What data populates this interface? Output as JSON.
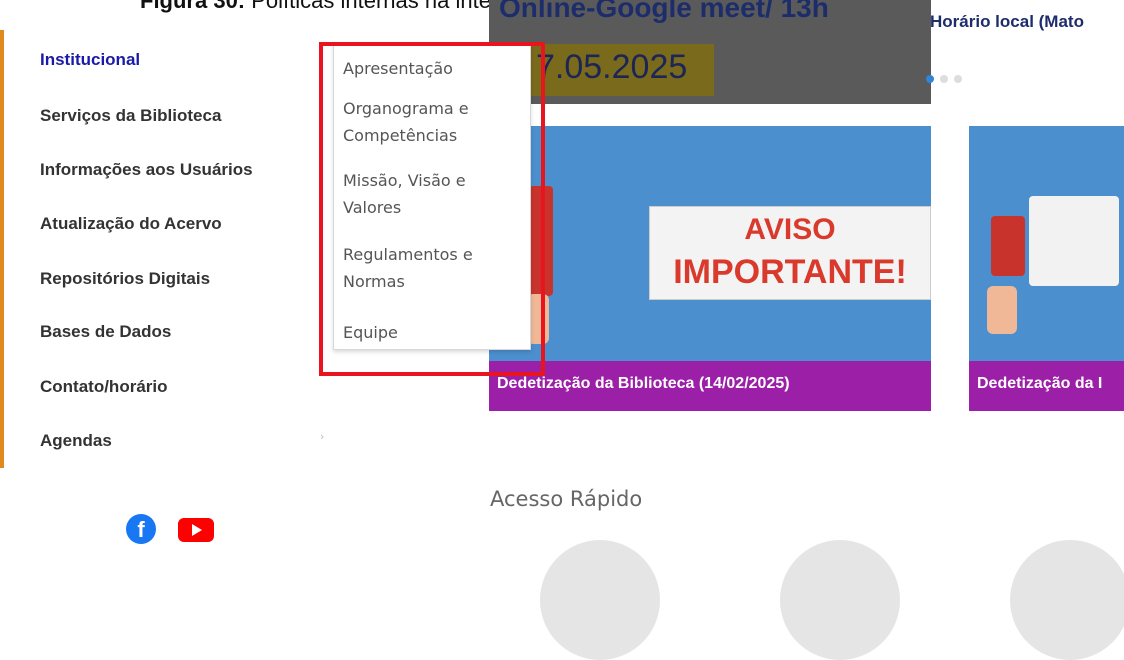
{
  "document_caption": {
    "bold": "Figura 30:",
    "text": " Políticas internas na interface da biblioteca da UFMT"
  },
  "banner": {
    "headline": "Online-Google meet/ 13h",
    "date": "7.05.2025",
    "horario": "Horário local (Mato"
  },
  "sidebar": {
    "items": [
      {
        "label": "Institucional"
      },
      {
        "label": "Serviços da Biblioteca"
      },
      {
        "label": "Informações aos Usuários"
      },
      {
        "label": "Atualização do Acervo"
      },
      {
        "label": "Repositórios Digitais"
      },
      {
        "label": "Bases de Dados"
      },
      {
        "label": "Contato/horário"
      },
      {
        "label": "Agendas"
      }
    ]
  },
  "submenu": {
    "items": [
      {
        "line1": "Apresentação",
        "line2": ""
      },
      {
        "line1": "Organograma e",
        "line2": "Competências"
      },
      {
        "line1": "Missão, Visão e",
        "line2": "Valores"
      },
      {
        "line1": "Regulamentos e",
        "line2": "Normas"
      },
      {
        "line1": "Equipe",
        "line2": ""
      }
    ]
  },
  "cards": [
    {
      "sign_line1": "AVISO",
      "sign_line2": "IMPORTANTE!",
      "caption": "Dedetização da Biblioteca (14/02/2025)"
    },
    {
      "caption": "Dedetização da I"
    }
  ],
  "quick_access": {
    "title": "Acesso Rápido"
  },
  "colors": {
    "accent_orange": "#e08a1e",
    "active_link": "#1a1aa8",
    "highlight_red": "#e8141e",
    "card_caption_bg": "#9c1fa8"
  },
  "icons": [
    "facebook-icon",
    "youtube-icon"
  ]
}
